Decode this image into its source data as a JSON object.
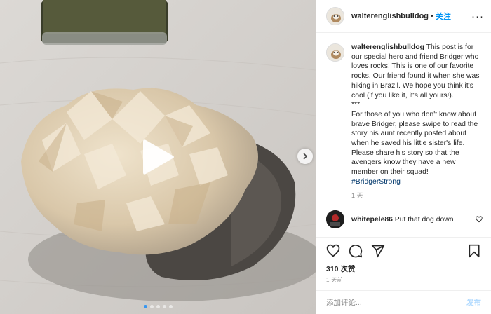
{
  "post": {
    "username": "walterenglishbulldog",
    "separator": "•",
    "follow_label": "关注",
    "more_label": "···"
  },
  "caption": {
    "username": "walterenglishbulldog",
    "text": "This post is for our special hero and friend Bridger who loves rocks! This is one of our favorite rocks. Our friend found it when she was hiking in Brazil. We hope you think it's cool (if you like it, it's all yours!).\n***\nFor those of you who don't know about brave Bridger, please swipe to read the story his aunt recently posted about when he saved his little sister's life. Please share his story so that the avengers know they have a new member on their squad!",
    "hashtag": "#BridgerStrong",
    "time": "1 天"
  },
  "comment": {
    "username": "whitepele86",
    "text": "Put that dog down"
  },
  "actions": {
    "like_icon": "heart-icon",
    "comment_icon": "comment-icon",
    "share_icon": "share-icon",
    "save_icon": "bookmark-icon"
  },
  "likes_label": "310 次赞",
  "date_label": "1 天前",
  "add_comment": {
    "placeholder": "添加评论...",
    "post_label": "发布"
  },
  "media": {
    "type": "video",
    "carousel_count": 5,
    "carousel_active": 1
  },
  "colors": {
    "link_blue": "#0095f6",
    "hashtag": "#00376b",
    "post_disabled": "#b3dbff"
  }
}
